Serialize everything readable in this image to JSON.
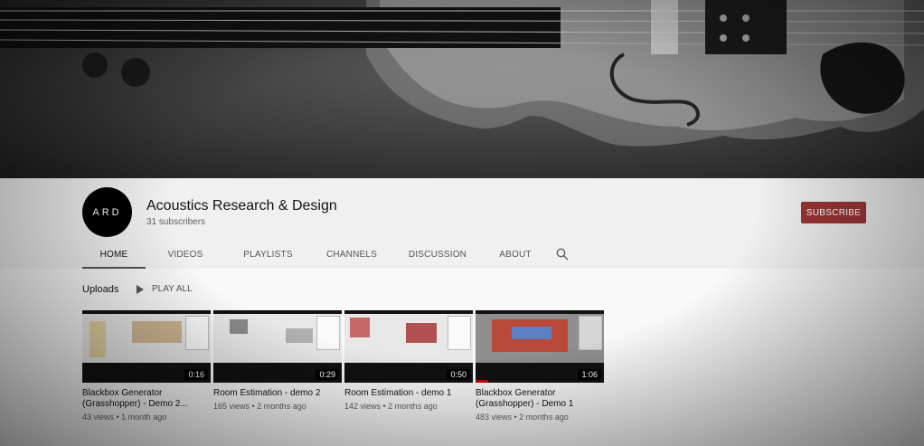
{
  "channel": {
    "avatar_text": "ARD",
    "name": "Acoustics Research & Design",
    "subscribers": "31 subscribers",
    "subscribe_label": "SUBSCRIBE"
  },
  "tabs": [
    {
      "label": "HOME",
      "active": true
    },
    {
      "label": "VIDEOS"
    },
    {
      "label": "PLAYLISTS"
    },
    {
      "label": "CHANNELS"
    },
    {
      "label": "DISCUSSION"
    },
    {
      "label": "ABOUT"
    }
  ],
  "search_icon": "search-icon",
  "uploads": {
    "title": "Uploads",
    "play_all_label": "PLAY ALL",
    "videos": [
      {
        "title": "Blackbox Generator (Grasshopper) - Demo 2...",
        "views": "43 views • 1 month ago",
        "duration": "0:16",
        "progress": 0
      },
      {
        "title": "Room Estimation - demo 2",
        "views": "165 views • 2 months ago",
        "duration": "0:29",
        "progress": 0
      },
      {
        "title": "Room Estimation - demo 1",
        "views": "142 views • 2 months ago",
        "duration": "0:50",
        "progress": 0
      },
      {
        "title": "Blackbox Generator (Grasshopper) - Demo 1",
        "views": "483 views • 2 months ago",
        "duration": "1:06",
        "progress": 0.1
      }
    ]
  },
  "colors": {
    "subscribe_bg": "#9b3535",
    "banner_dark": "#1c1c1c",
    "progress_red": "#cc0000"
  }
}
